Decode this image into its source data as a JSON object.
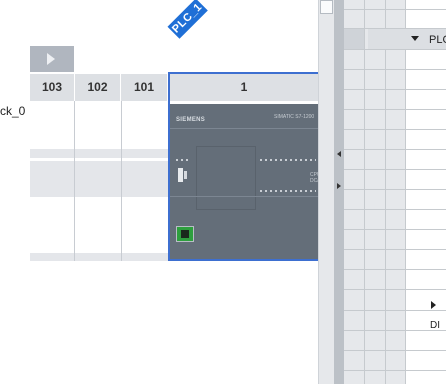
{
  "canvas": {
    "plc_tag": "PLC_1",
    "rack_label": "ck_0",
    "slots": [
      {
        "label": "103"
      },
      {
        "label": "102"
      },
      {
        "label": "101"
      },
      {
        "label": "1"
      }
    ],
    "cpu": {
      "brand": "SIEMENS",
      "model": "SIMATIC S7-1200",
      "right_label": "CPU\nDC/"
    }
  },
  "grid": {
    "row_plc_label": "PLC",
    "row_di_label": "DI"
  },
  "colors": {
    "selection_border": "#3d6fd0",
    "plc_tag_bg": "#1f6fd6",
    "module_body": "#646e79",
    "port_green": "#2e9f3e"
  }
}
